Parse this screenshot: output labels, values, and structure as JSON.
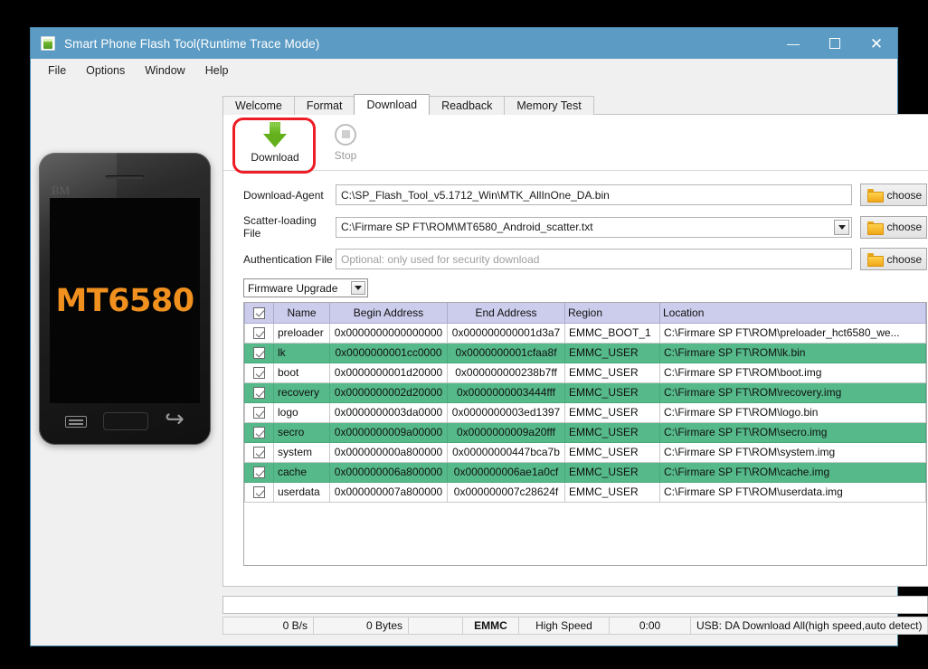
{
  "window": {
    "title": "Smart Phone Flash Tool(Runtime Trace Mode)",
    "icon": "flash-tool-icon",
    "accent_color": "#5b9bc4",
    "controls": {
      "minimize": "minimize-icon",
      "maximize": "maximize-icon",
      "close": "close-icon"
    }
  },
  "menu": {
    "items": [
      "File",
      "Options",
      "Window",
      "Help"
    ]
  },
  "phone": {
    "watermark": "BM",
    "model": "MT6580",
    "model_color": "#f0901e",
    "nav": [
      "menu-button",
      "home-button",
      "back-button"
    ]
  },
  "tabs": [
    {
      "label": "Welcome",
      "active": false
    },
    {
      "label": "Format",
      "active": false
    },
    {
      "label": "Download",
      "active": true
    },
    {
      "label": "Readback",
      "active": false
    },
    {
      "label": "Memory Test",
      "active": false
    }
  ],
  "toolbar": {
    "download_label": "Download",
    "download_icon": "download-arrow-icon",
    "stop_label": "Stop",
    "stop_icon": "stop-circle-icon",
    "highlight_color": "#ee1c25"
  },
  "fields": [
    {
      "label": "Download-Agent",
      "value": "C:\\SP_Flash_Tool_v5.1712_Win\\MTK_AllInOne_DA.bin",
      "placeholder": "",
      "is_combo": false,
      "button": "choose"
    },
    {
      "label": "Scatter-loading File",
      "value": "C:\\Firmare SP FT\\ROM\\MT6580_Android_scatter.txt",
      "placeholder": "",
      "is_combo": true,
      "button": "choose"
    },
    {
      "label": "Authentication File",
      "value": "",
      "placeholder": "Optional: only used for security download",
      "is_combo": false,
      "button": "choose"
    }
  ],
  "mode_select": {
    "value": "Firmware Upgrade"
  },
  "table": {
    "columns": [
      "",
      "Name",
      "Begin Address",
      "End Address",
      "Region",
      "Location"
    ],
    "header_checkbox": true,
    "rows": [
      {
        "checked": true,
        "highlighted": false,
        "name": "preloader",
        "begin": "0x0000000000000000",
        "end": "0x000000000001d3a7",
        "region": "EMMC_BOOT_1",
        "location": "C:\\Firmare SP FT\\ROM\\preloader_hct6580_we..."
      },
      {
        "checked": true,
        "highlighted": true,
        "name": "lk",
        "begin": "0x0000000001cc0000",
        "end": "0x0000000001cfaa8f",
        "region": "EMMC_USER",
        "location": "C:\\Firmare SP FT\\ROM\\lk.bin"
      },
      {
        "checked": true,
        "highlighted": false,
        "name": "boot",
        "begin": "0x0000000001d20000",
        "end": "0x000000000238b7ff",
        "region": "EMMC_USER",
        "location": "C:\\Firmare SP FT\\ROM\\boot.img"
      },
      {
        "checked": true,
        "highlighted": true,
        "name": "recovery",
        "begin": "0x0000000002d20000",
        "end": "0x0000000003444fff",
        "region": "EMMC_USER",
        "location": "C:\\Firmare SP FT\\ROM\\recovery.img"
      },
      {
        "checked": true,
        "highlighted": false,
        "name": "logo",
        "begin": "0x0000000003da0000",
        "end": "0x0000000003ed1397",
        "region": "EMMC_USER",
        "location": "C:\\Firmare SP FT\\ROM\\logo.bin"
      },
      {
        "checked": true,
        "highlighted": true,
        "name": "secro",
        "begin": "0x0000000009a00000",
        "end": "0x0000000009a20fff",
        "region": "EMMC_USER",
        "location": "C:\\Firmare SP FT\\ROM\\secro.img"
      },
      {
        "checked": true,
        "highlighted": false,
        "name": "system",
        "begin": "0x000000000a800000",
        "end": "0x00000000447bca7b",
        "region": "EMMC_USER",
        "location": "C:\\Firmare SP FT\\ROM\\system.img"
      },
      {
        "checked": true,
        "highlighted": true,
        "name": "cache",
        "begin": "0x000000006a800000",
        "end": "0x000000006ae1a0cf",
        "region": "EMMC_USER",
        "location": "C:\\Firmare SP FT\\ROM\\cache.img"
      },
      {
        "checked": true,
        "highlighted": false,
        "name": "userdata",
        "begin": "0x000000007a800000",
        "end": "0x000000007c28624f",
        "region": "EMMC_USER",
        "location": "C:\\Firmare SP FT\\ROM\\userdata.img"
      }
    ],
    "highlight_color": "#55b98a",
    "header_color": "#ccccec"
  },
  "statusbar": {
    "speed": "0 B/s",
    "bytes": "0 Bytes",
    "blank": "",
    "storage": "EMMC",
    "link_speed": "High Speed",
    "elapsed": "0:00",
    "connection": "USB: DA Download All(high speed,auto detect)"
  }
}
